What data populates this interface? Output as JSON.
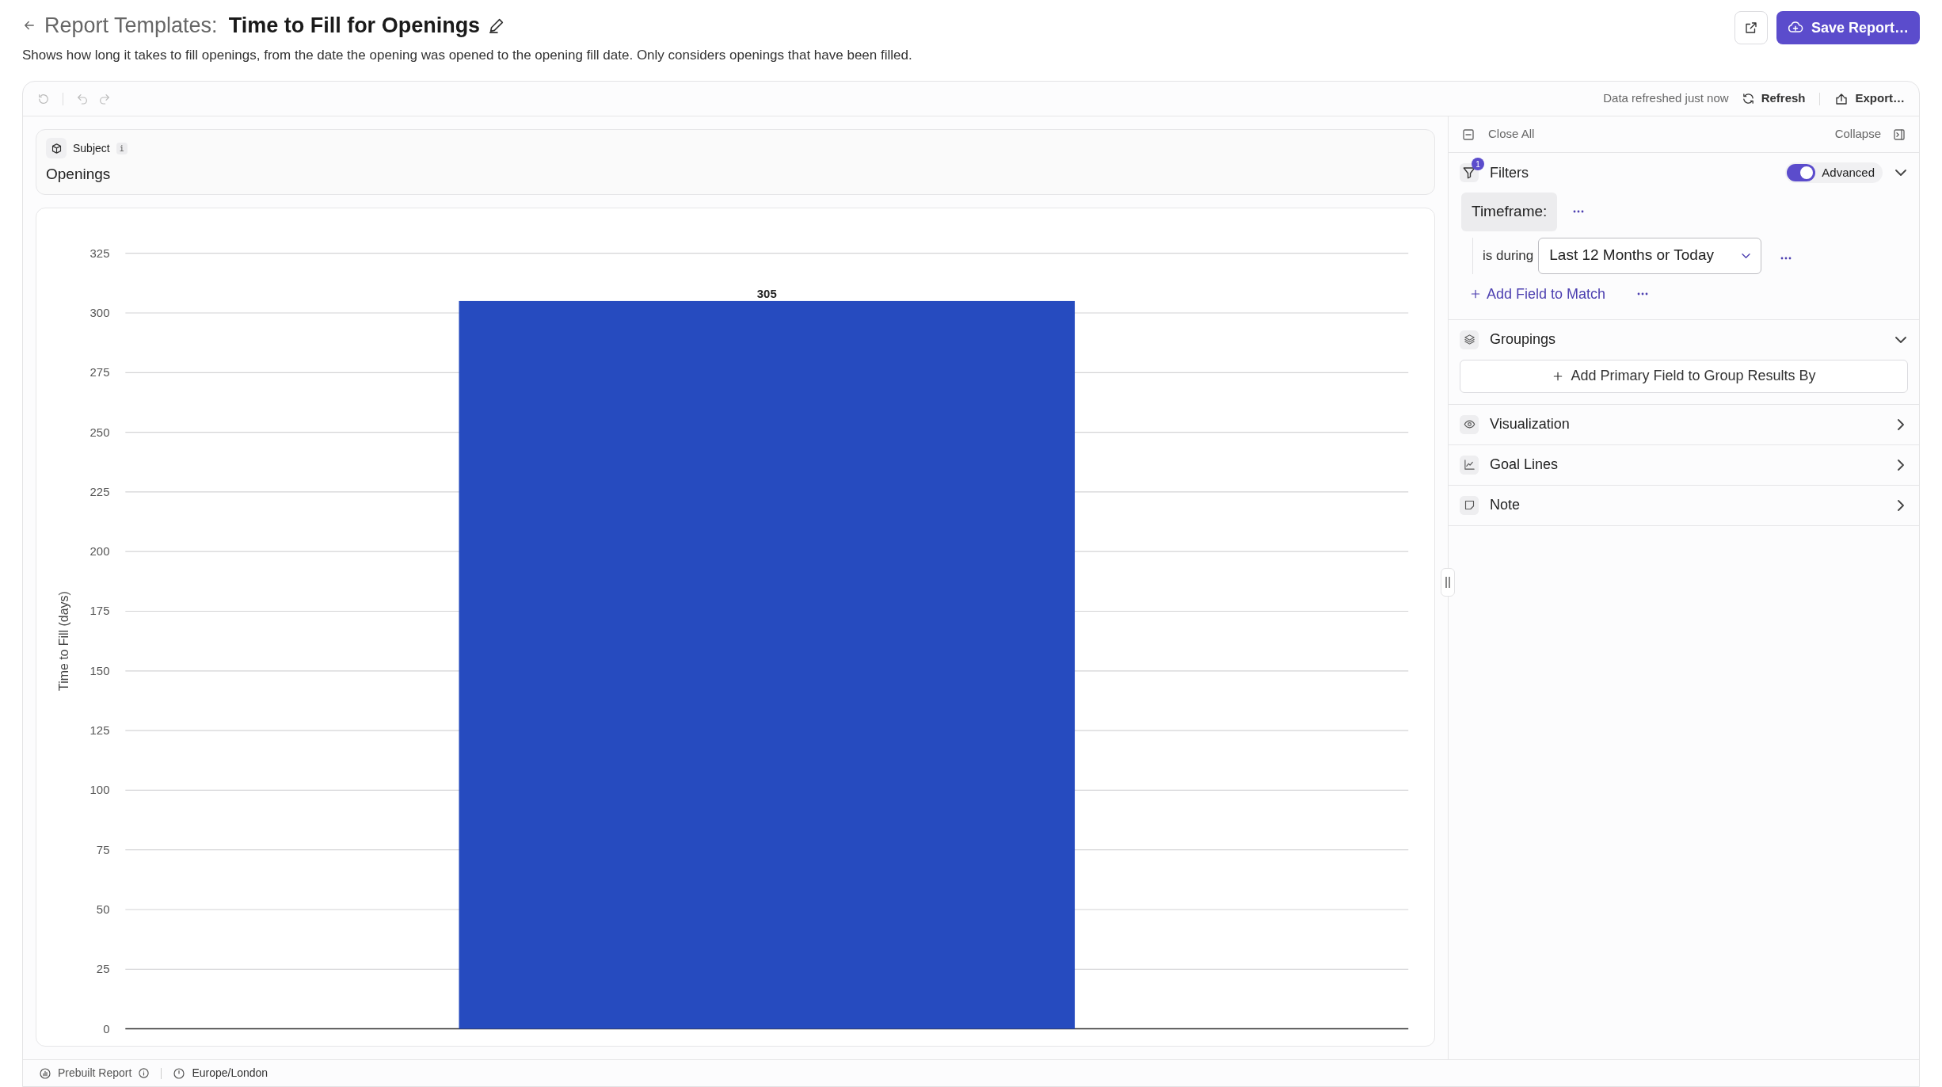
{
  "header": {
    "breadcrumb": "Report Templates:",
    "title": "Time to Fill for Openings",
    "description": "Shows how long it takes to fill openings, from the date the opening was opened to the opening fill date. Only considers openings that have been filled."
  },
  "actions": {
    "save_label": "Save Report…"
  },
  "toolbar": {
    "status": "Data refreshed just now",
    "refresh": "Refresh",
    "export": "Export…"
  },
  "subject": {
    "label": "Subject",
    "info": "i",
    "value": "Openings"
  },
  "chart": {
    "chart_data": {
      "type": "bar",
      "ylabel": "Time to Fill (days)",
      "values": [
        305
      ],
      "ylim": [
        0,
        325
      ],
      "yticks": [
        0,
        25,
        50,
        75,
        100,
        125,
        150,
        175,
        200,
        225,
        250,
        275,
        300,
        325
      ],
      "data_labels": true,
      "grid": true
    }
  },
  "panel": {
    "close_all": "Close All",
    "collapse": "Collapse",
    "sections": [
      {
        "kind": "filters",
        "title": "Filters",
        "badge": "1",
        "expanded": true,
        "advanced": {
          "label": "Advanced",
          "on": true
        },
        "filter": {
          "field": "Timeframe:",
          "operator": "is during",
          "value": "Last 12 Months or Today"
        },
        "add_label": "Add Field to Match"
      },
      {
        "kind": "groupings",
        "title": "Groupings",
        "expanded": true,
        "add_label": "Add Primary Field to Group Results By"
      },
      {
        "kind": "visualization",
        "title": "Visualization",
        "expanded": false
      },
      {
        "kind": "goal_lines",
        "title": "Goal Lines",
        "expanded": false
      },
      {
        "kind": "note",
        "title": "Note",
        "expanded": false
      }
    ]
  },
  "footer": {
    "source": "Prebuilt Report",
    "timezone": "Europe/London"
  }
}
